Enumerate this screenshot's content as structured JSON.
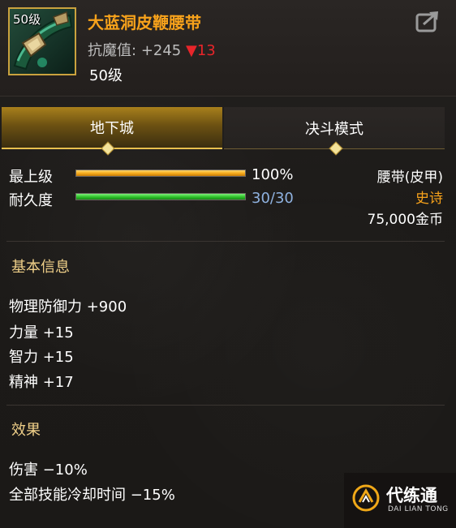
{
  "item": {
    "icon_level": "50级",
    "name": "大蓝洞皮鞭腰带",
    "magic_resist_label": "抗魔值:",
    "magic_resist_value": "+245",
    "magic_resist_diff": "▼13",
    "level": "50级"
  },
  "tabs": [
    {
      "label": "地下城",
      "active": true
    },
    {
      "label": "决斗模式",
      "active": false
    }
  ],
  "stats": {
    "top_level_label": "最上级",
    "top_level_value": "100%",
    "top_level_fraction": 1.0,
    "durability_label": "耐久度",
    "durability_value": "30/30",
    "durability_fraction": 1.0
  },
  "info": {
    "type": "腰带(皮甲)",
    "rarity": "史诗",
    "price": "75,000金币"
  },
  "basic": {
    "title": "基本信息",
    "attrs": [
      "物理防御力 +900",
      "力量 +15",
      "智力 +15",
      "精神 +17"
    ]
  },
  "effects": {
    "title": "效果",
    "items": [
      "伤害 −10%",
      "全部技能冷却时间 −15%"
    ]
  },
  "watermark": {
    "title": "代练通",
    "subtitle": "DAI LIAN TONG"
  },
  "colors": {
    "item_name": "#f7a21b",
    "rarity": "#f7a21b",
    "decrease": "#e8252a",
    "durability_text": "#8fb2e0",
    "section_title": "#f0d089"
  }
}
